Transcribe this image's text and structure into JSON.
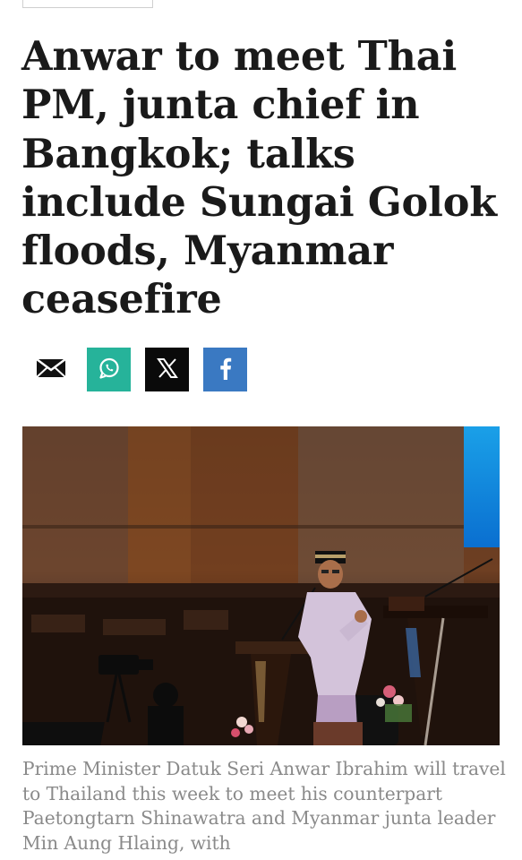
{
  "article": {
    "headline": "Anwar to meet Thai PM, junta chief in Bangkok; talks include Sungai Golok floods, Myanmar ceasefire",
    "caption": "Prime Minister Datuk Seri Anwar Ibrahim will travel to Thailand this week to meet his counterpart Paetongtarn Shinawatra and Myanmar junta leader Min Aung Hlaing, with"
  },
  "share": {
    "buttons": [
      {
        "name": "email",
        "icon": "envelope-icon"
      },
      {
        "name": "whatsapp",
        "icon": "whatsapp-icon",
        "color": "#26b39a"
      },
      {
        "name": "x",
        "icon": "x-icon",
        "color": "#0a0a0a"
      },
      {
        "name": "facebook",
        "icon": "facebook-icon",
        "color": "#3a79c2"
      }
    ]
  },
  "colors": {
    "headline": "#1a1a1a",
    "caption": "#8a8a8a"
  }
}
